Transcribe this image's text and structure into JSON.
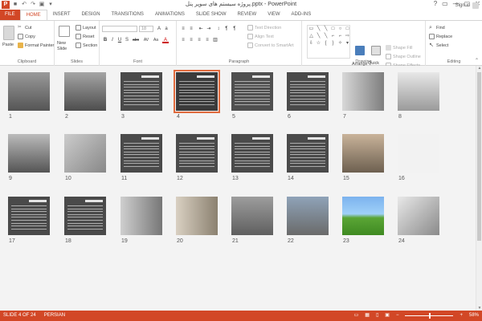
{
  "window": {
    "title": "پروژه سیستم های سوپر پنل.pptx - PowerPoint",
    "controls": [
      "?",
      "▭",
      "—",
      "▢",
      "✕"
    ]
  },
  "tabs": [
    "FILE",
    "HOME",
    "INSERT",
    "DESIGN",
    "TRANSITIONS",
    "ANIMATIONS",
    "SLIDE SHOW",
    "REVIEW",
    "VIEW",
    "ADD-INS"
  ],
  "active_tab": "HOME",
  "signin": "Sign in",
  "ribbon": {
    "clipboard": {
      "label": "Clipboard",
      "paste": "Paste",
      "cut": "Cut",
      "copy": "Copy",
      "format_painter": "Format Painter"
    },
    "slides": {
      "label": "Slides",
      "new_slide": "New Slide",
      "layout": "Layout",
      "reset": "Reset",
      "section": "Section"
    },
    "font": {
      "label": "Font",
      "size": "18",
      "buttons": [
        "B",
        "I",
        "U",
        "S",
        "abc",
        "AV",
        "Aa",
        "A"
      ]
    },
    "paragraph": {
      "label": "Paragraph",
      "text_direction": "Text Direction",
      "align_text": "Align Text",
      "convert_smartart": "Convert to SmartArt"
    },
    "drawing": {
      "label": "Drawing",
      "arrange": "Arrange",
      "quick_styles": "Quick Styles",
      "shape_fill": "Shape Fill",
      "shape_outline": "Shape Outline",
      "shape_effects": "Shape Effects"
    },
    "editing": {
      "label": "Editing",
      "find": "Find",
      "replace": "Replace",
      "select": "Select"
    }
  },
  "slides": [
    {
      "n": "1"
    },
    {
      "n": "2"
    },
    {
      "n": "3"
    },
    {
      "n": "4"
    },
    {
      "n": "5"
    },
    {
      "n": "6"
    },
    {
      "n": "7"
    },
    {
      "n": "8"
    },
    {
      "n": "9"
    },
    {
      "n": "10"
    },
    {
      "n": "11"
    },
    {
      "n": "12"
    },
    {
      "n": "13"
    },
    {
      "n": "14"
    },
    {
      "n": "15"
    },
    {
      "n": "16"
    },
    {
      "n": "17"
    },
    {
      "n": "18"
    },
    {
      "n": "19"
    },
    {
      "n": "20"
    },
    {
      "n": "21"
    },
    {
      "n": "22"
    },
    {
      "n": "23"
    },
    {
      "n": "24"
    }
  ],
  "selected_slide": "4",
  "status": {
    "slide_info": "SLIDE 4 OF 24",
    "language": "PERSIAN",
    "zoom": "58%"
  },
  "colors": {
    "accent": "#d24726",
    "selection": "#e06b3e",
    "sorter_bg": "#f3f3f3"
  }
}
